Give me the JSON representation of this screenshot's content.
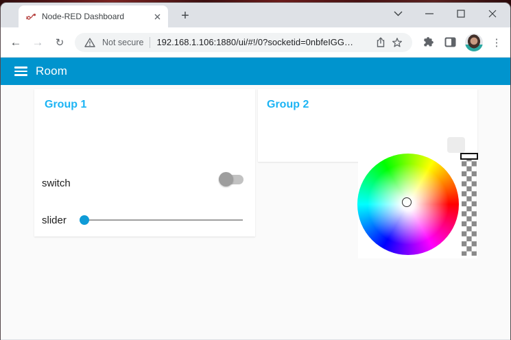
{
  "browser": {
    "tab_title": "Node-RED Dashboard",
    "security_label": "Not secure",
    "url": "192.168.1.106:1880/ui/#!/0?socketid=0nbfeIGG…",
    "icons": {
      "back": "←",
      "forward": "→",
      "reload": "↻",
      "new_tab": "+",
      "menu_dots": "⋮"
    }
  },
  "dashboard": {
    "title": "Room",
    "colors": {
      "header_bar": "#0094ce",
      "group_title": "#1cb4f4",
      "slider_thumb": "#0f9bd7",
      "toggle_thumb": "#9e9e9e",
      "page_background": "#fafafa"
    },
    "groups": [
      {
        "title": "Group 1",
        "widgets": [
          {
            "type": "switch",
            "label": "switch",
            "state": "off"
          },
          {
            "type": "slider",
            "label": "slider",
            "value": "minimum"
          }
        ]
      },
      {
        "title": "Group 2",
        "widgets": [
          {
            "type": "colour-picker",
            "state": "open",
            "selection": "center (white)",
            "alpha": "top (opaque)"
          }
        ]
      }
    ]
  }
}
